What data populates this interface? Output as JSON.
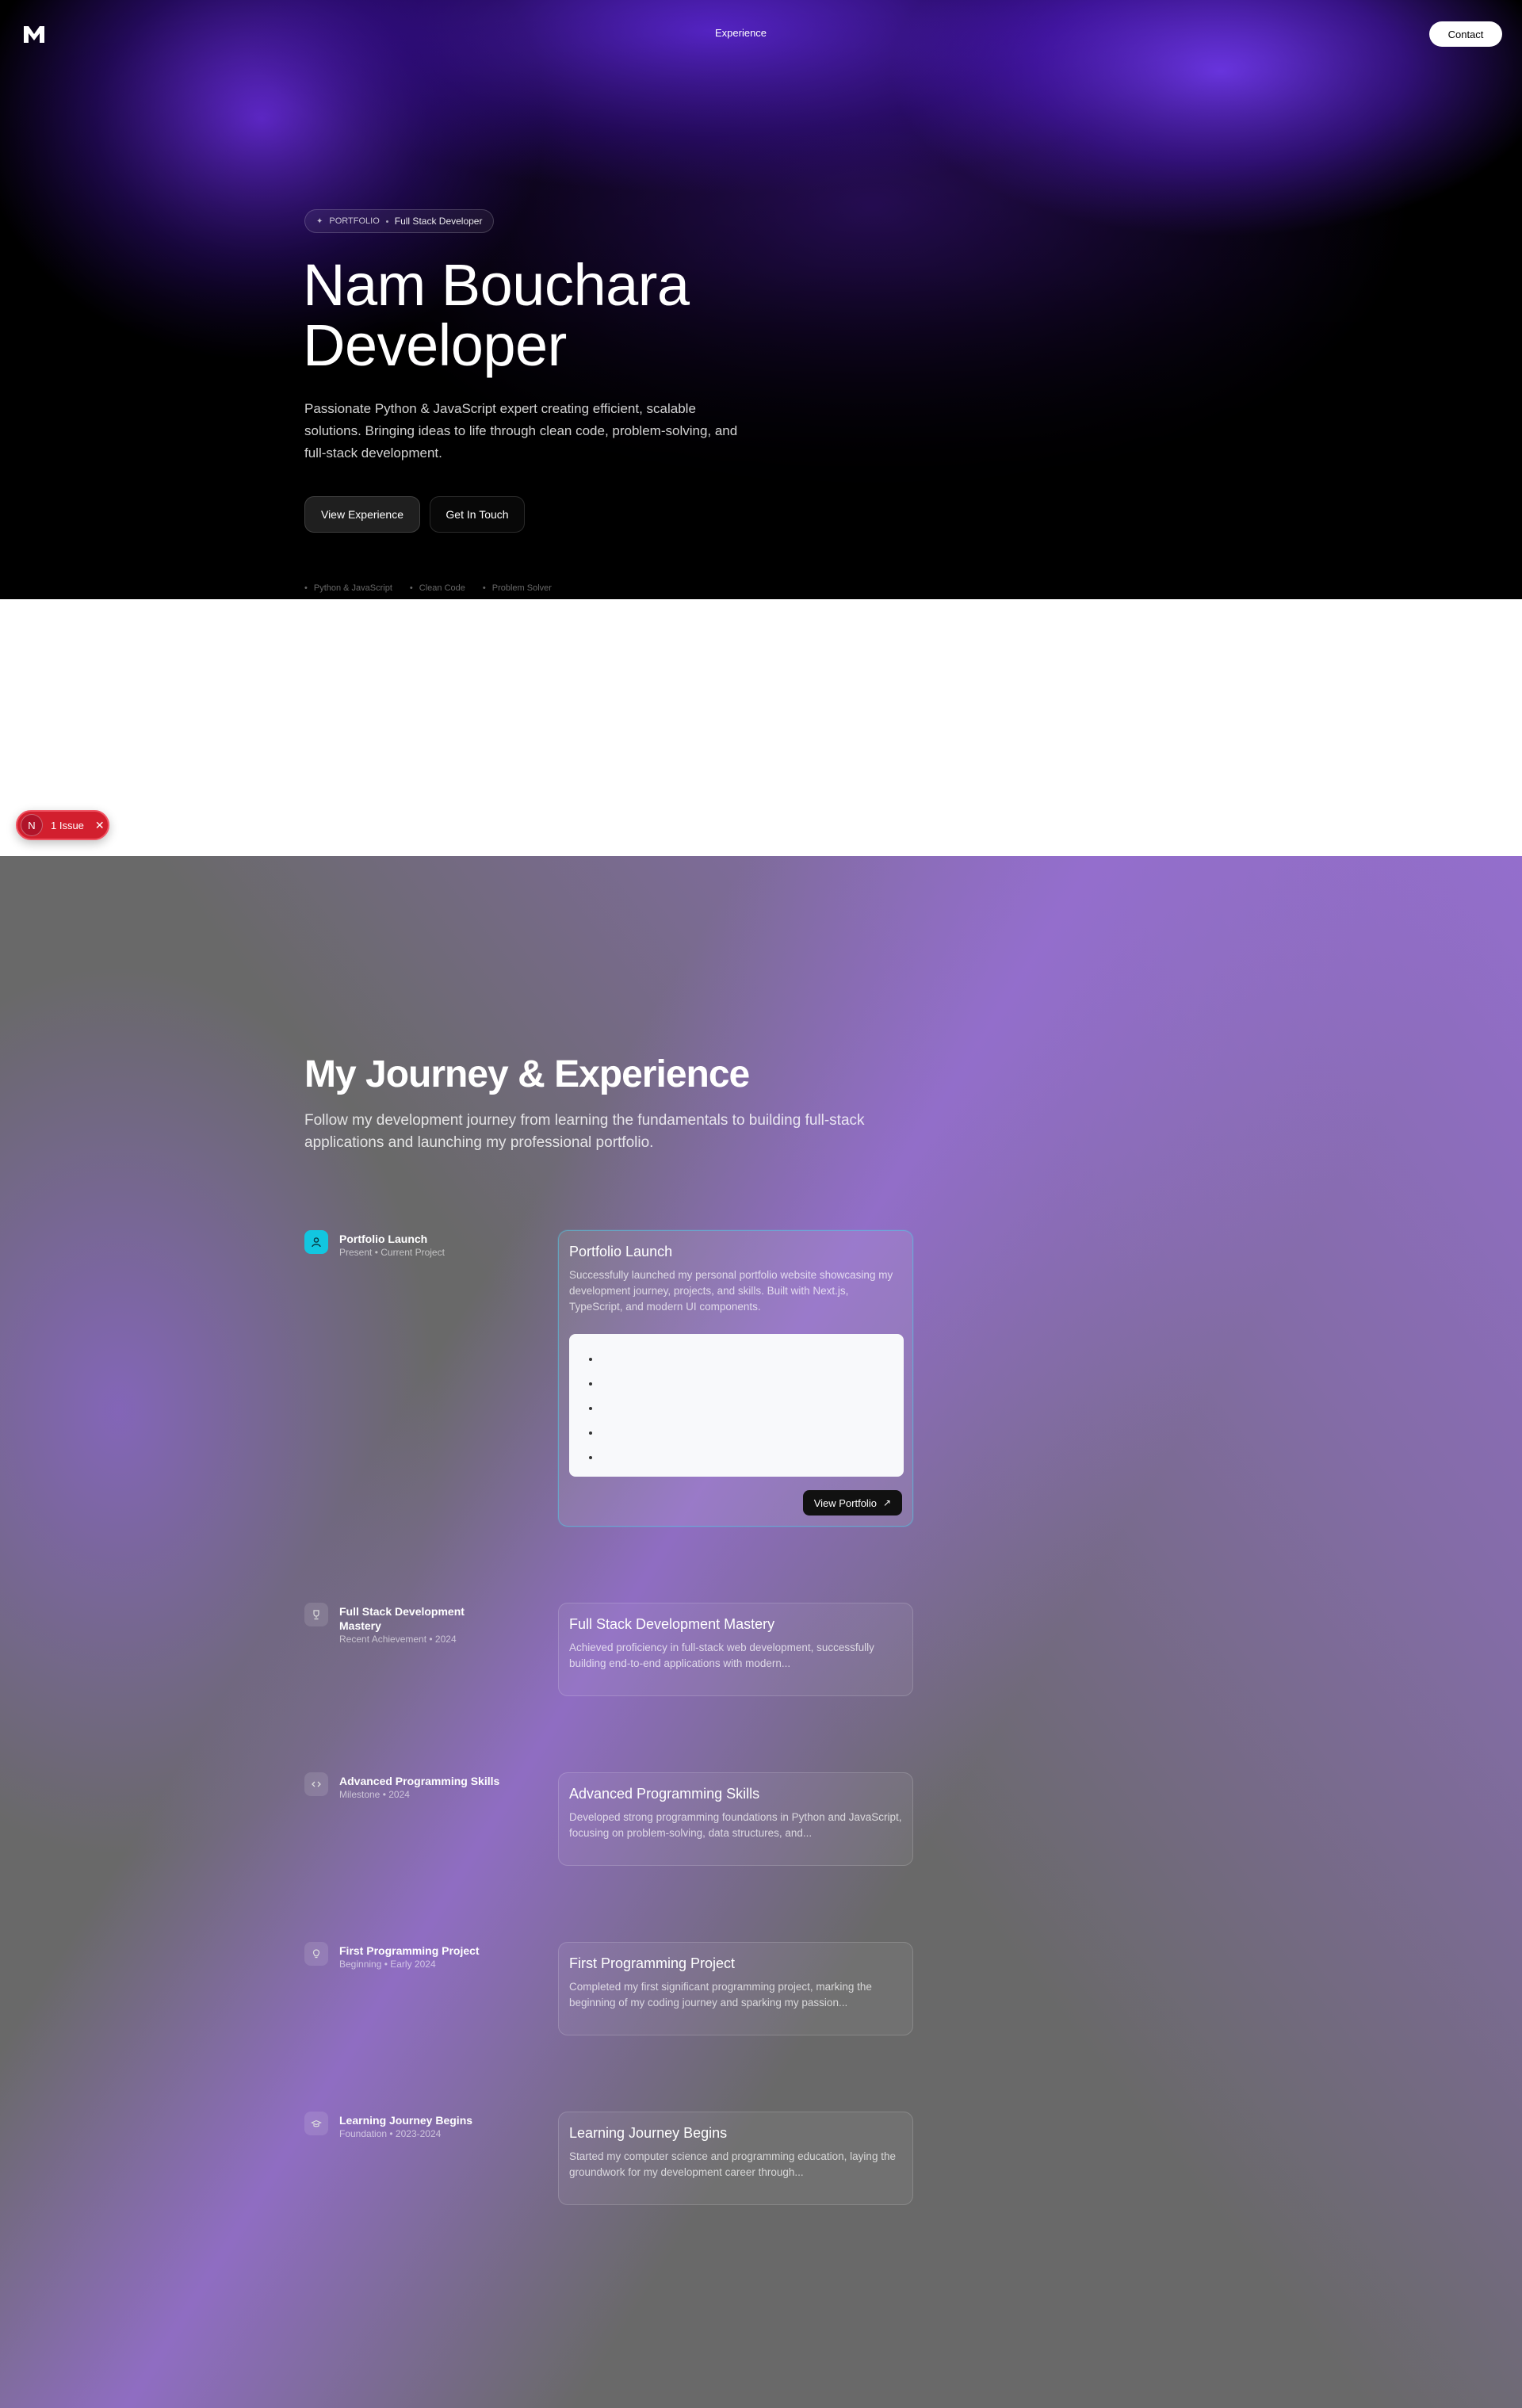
{
  "nav": {
    "logo_alt": "M logo",
    "link": "Experience",
    "contact": "Contact"
  },
  "hero": {
    "badge_icon": "sparkle-icon",
    "badge_tag": "PORTFOLIO",
    "badge_role": "Full Stack Developer",
    "title_line1": "Nam Bouchara",
    "title_line2": "Developer",
    "description": "Passionate Python & JavaScript expert creating efficient, scalable solutions. Bringing ideas to life through clean code, problem-solving, and full-stack development.",
    "primary_button": "View Experience",
    "secondary_button": "Get In Touch",
    "tags": [
      "Python & JavaScript",
      "Clean Code",
      "Problem Solver"
    ]
  },
  "issue_badge": {
    "letter": "N",
    "label": "1 Issue",
    "close": "✕"
  },
  "journey": {
    "title": "My Journey & Experience",
    "subtitle": "Follow my development journey from learning the fundamentals to building full-stack applications and launching my professional portfolio.",
    "items": [
      {
        "icon": "user-icon",
        "name": "Portfolio Launch",
        "meta": "Present • Current Project",
        "card_title": "Portfolio Launch",
        "card_desc": "Successfully launched my personal portfolio website showcasing my development journey, projects, and skills. Built with Next.js, TypeScript, and modern UI components.",
        "highlights": [
          "",
          "",
          "",
          "",
          ""
        ],
        "button": "View Portfolio",
        "button_icon": "arrow-up-right-icon"
      },
      {
        "icon": "trophy-icon",
        "name": "Full Stack Development Mastery",
        "meta": "Recent Achievement • 2024",
        "card_title": "Full Stack Development Mastery",
        "card_desc": "Achieved proficiency in full-stack web development, successfully building end-to-end applications with modern..."
      },
      {
        "icon": "code-icon",
        "name": "Advanced Programming Skills",
        "meta": "Milestone • 2024",
        "card_title": "Advanced Programming Skills",
        "card_desc": "Developed strong programming foundations in Python and JavaScript, focusing on problem-solving, data structures, and..."
      },
      {
        "icon": "lightbulb-icon",
        "name": "First Programming Project",
        "meta": "Beginning • Early 2024",
        "card_title": "First Programming Project",
        "card_desc": "Completed my first significant programming project, marking the beginning of my coding journey and sparking my passion..."
      },
      {
        "icon": "graduation-cap-icon",
        "name": "Learning Journey Begins",
        "meta": "Foundation • 2023-2024",
        "card_title": "Learning Journey Begins",
        "card_desc": "Started my computer science and programming education, laying the groundwork for my development career through..."
      }
    ]
  },
  "colors": {
    "accent": "#12c6e0",
    "hero_purple": "#7a3cff",
    "issue_red": "#d21f2e"
  }
}
